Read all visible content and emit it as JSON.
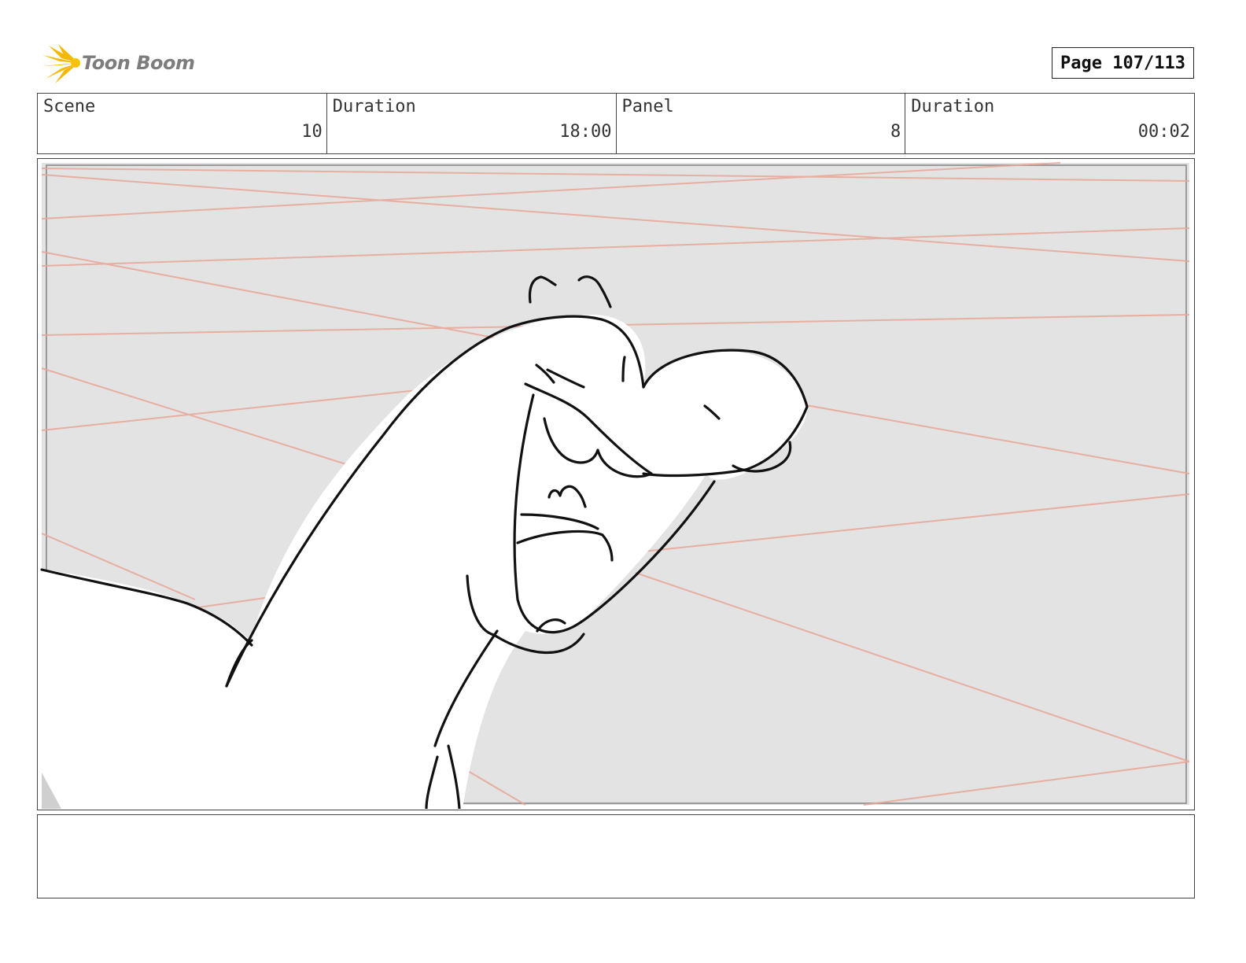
{
  "header": {
    "brand": "Toon Boom",
    "brand_icon": "starburst-icon",
    "page_label": "Page 107/113"
  },
  "info": {
    "scene_label": "Scene",
    "scene_value": "10",
    "scene_duration_label": "Duration",
    "scene_duration_value": "18:00",
    "panel_label": "Panel",
    "panel_value": "8",
    "panel_duration_label": "Duration",
    "panel_duration_value": "00:02"
  },
  "colors": {
    "background_fill": "#e3e3e3",
    "guide_lines": "#e8a596",
    "ink": "#111111",
    "logo_yellow": "#f5b800"
  },
  "notes": {
    "text": ""
  }
}
